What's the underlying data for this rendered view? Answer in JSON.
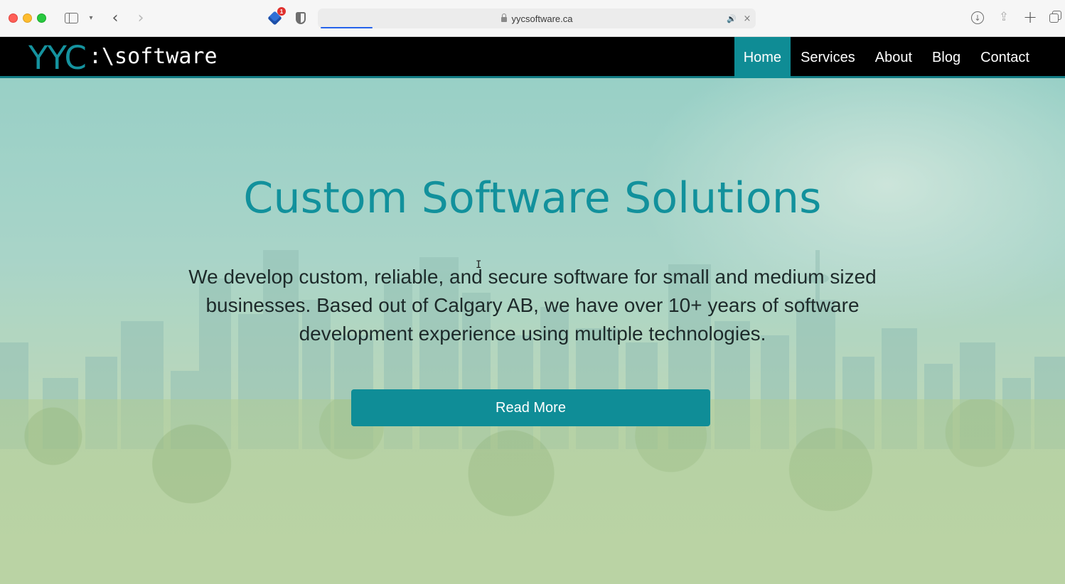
{
  "browser": {
    "url": "yycsoftware.ca",
    "extension_badge": "1",
    "back_glyph": "‹",
    "forward_glyph": "›",
    "new_tab_glyph": "+",
    "close_glyph": "×",
    "load_progress": 0.12
  },
  "site": {
    "logo": {
      "brand": "YYC",
      "suffix": ":\\software"
    },
    "nav": {
      "items": [
        {
          "label": "Home",
          "active": true
        },
        {
          "label": "Services",
          "active": false
        },
        {
          "label": "About",
          "active": false
        },
        {
          "label": "Blog",
          "active": false
        },
        {
          "label": "Contact",
          "active": false
        }
      ]
    },
    "hero": {
      "title": "Custom Software Solutions",
      "description": "We develop custom, reliable, and secure software for small and medium sized businesses. Based out of Calgary AB, we have over 10+ years of software development experience using multiple technologies.",
      "cta_label": "Read More"
    }
  },
  "colors": {
    "accent": "#0f8d97",
    "brand_teal": "#15939f",
    "navbar_bg": "#000000",
    "title_color": "#12919c"
  },
  "icons": {
    "sidebar": "sidebar-icon",
    "extension": "extension-cube-icon",
    "privacy": "shield-icon",
    "lock": "lock-icon",
    "audio": "speaker-icon",
    "download": "download-icon",
    "share": "share-icon",
    "tabs": "tab-overview-icon"
  }
}
